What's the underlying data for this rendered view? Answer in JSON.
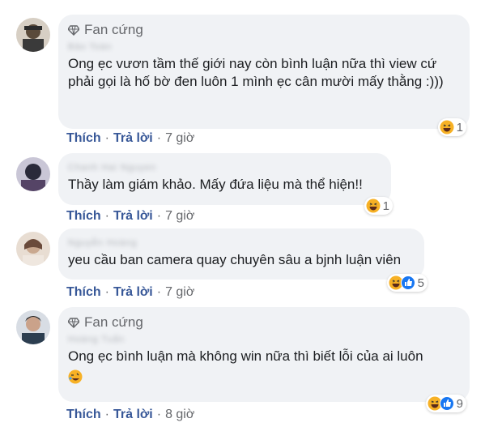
{
  "comments": [
    {
      "badge": "Fan cứng",
      "name": "Bảo Toàn",
      "text": "Ong ẹc vươn tầm thế giới nay còn bình luận nữa thì view cứ phải gọi là hố bờ đen luôn 1 mình ẹc cân mười mấy thằng :)))",
      "reaction_count": "1",
      "like": "Thích",
      "reply": "Trả lời",
      "time": "7 giờ"
    },
    {
      "name": "Chanh Hai Nguyen",
      "text": "Thầy làm giám khảo. Mấy đứa liệu mà thể hiện!!",
      "reaction_count": "1",
      "like": "Thích",
      "reply": "Trả lời",
      "time": "7 giờ"
    },
    {
      "name": "Nguyễn Hoàng",
      "text": "yeu cầu ban camera quay chuyên sâu a bjnh luận viên",
      "reaction_count": "5",
      "like": "Thích",
      "reply": "Trả lời",
      "time": "7 giờ"
    },
    {
      "badge": "Fan cứng",
      "name": "Hoàng Tuấn",
      "text": "Ong ẹc bình luận mà không win nữa thì biết lỗi của ai luôn",
      "reaction_count": "9",
      "like": "Thích",
      "reply": "Trả lời",
      "time": "8 giờ"
    }
  ],
  "colors": {
    "link": "#385898",
    "bubble": "#f0f2f5",
    "muted": "#65676b"
  },
  "icons": [
    "diamond-icon",
    "haha-reaction-icon",
    "like-reaction-icon"
  ]
}
